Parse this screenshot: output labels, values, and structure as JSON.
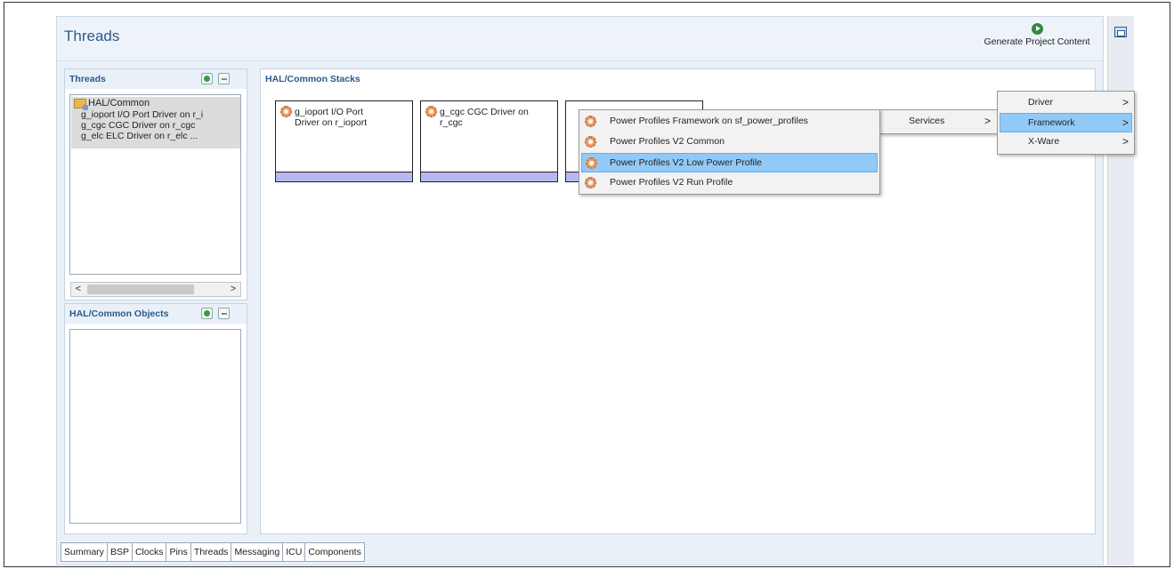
{
  "editor": {
    "title": "Threads",
    "generate_button": "Generate Project Content"
  },
  "threads_panel": {
    "title": "Threads",
    "tree": {
      "root": "HAL/Common",
      "children": [
        "g_ioport I/O Port Driver on r_i",
        "g_cgc CGC Driver on r_cgc",
        "g_elc ELC Driver on r_elc ..."
      ]
    },
    "scroll_left": "<",
    "scroll_right": ">"
  },
  "objects_panel": {
    "title": "HAL/Common Objects"
  },
  "stacks_panel": {
    "title": "HAL/Common Stacks",
    "stacks": [
      {
        "line1": "g_ioport I/O Port",
        "line2": "Driver on r_ioport"
      },
      {
        "line1": "g_cgc CGC Driver on",
        "line2": "r_cgc"
      }
    ]
  },
  "context_menu": {
    "services": "Services",
    "arrow": ">",
    "categories": [
      {
        "label": "Driver",
        "arrow": ">"
      },
      {
        "label": "Framework",
        "arrow": ">"
      },
      {
        "label": "X-Ware",
        "arrow": ">"
      }
    ],
    "framework_items": [
      "Power Profiles Framework on sf_power_profiles",
      "Power Profiles V2 Common",
      "Power Profiles V2 Low Power Profile",
      "Power Profiles V2 Run Profile"
    ]
  },
  "bottom_tabs": [
    "Summary",
    "BSP",
    "Clocks",
    "Pins",
    "Threads",
    "Messaging",
    "ICU",
    "Components"
  ],
  "colors": {
    "accent": "#2c5a8c",
    "highlight": "#91c9f7",
    "stack_bar": "#b8b8f0"
  }
}
